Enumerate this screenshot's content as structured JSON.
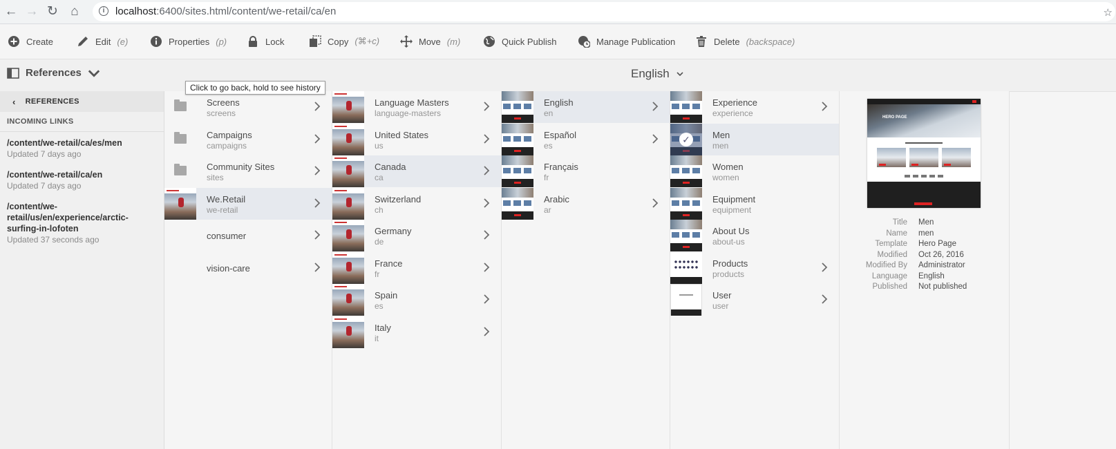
{
  "browser": {
    "url_host": "localhost",
    "url_rest": ":6400/sites.html/content/we-retail/ca/en"
  },
  "toolbar": [
    {
      "label": "Create",
      "kbd": "",
      "icon": "plus-circle-icon"
    },
    {
      "label": "Edit",
      "kbd": "(e)",
      "icon": "pencil-icon"
    },
    {
      "label": "Properties",
      "kbd": "(p)",
      "icon": "info-icon"
    },
    {
      "label": "Lock",
      "kbd": "",
      "icon": "lock-icon"
    },
    {
      "label": "Copy",
      "kbd": "(⌘+c)",
      "icon": "copy-icon"
    },
    {
      "label": "Move",
      "kbd": "(m)",
      "icon": "move-icon"
    },
    {
      "label": "Quick Publish",
      "kbd": "",
      "icon": "globe-icon"
    },
    {
      "label": "Manage Publication",
      "kbd": "",
      "icon": "globe-clock-icon"
    },
    {
      "label": "Delete",
      "kbd": "(backspace)",
      "icon": "trash-icon"
    }
  ],
  "rail": {
    "toggle_label": "References",
    "back_label": "REFERENCES",
    "section": "INCOMING LINKS",
    "links": [
      {
        "path": "/content/we-retail/ca/es/men",
        "updated": "Updated 7 days ago"
      },
      {
        "path": "/content/we-retail/ca/en",
        "updated": "Updated 7 days ago"
      },
      {
        "path": "/content/we-retail/us/en/experience/arctic-surfing-in-lofoten",
        "updated": "Updated 37 seconds ago"
      }
    ]
  },
  "header": {
    "title": "English"
  },
  "tooltip": "Click to go back, hold to see history",
  "columns": [
    [
      {
        "title": "Screens",
        "name": "screens",
        "thumb": "folder",
        "chevron": true,
        "selected": false
      },
      {
        "title": "Campaigns",
        "name": "campaigns",
        "thumb": "folder",
        "chevron": true,
        "selected": false
      },
      {
        "title": "Community Sites",
        "name": "sites",
        "thumb": "folder",
        "chevron": true,
        "selected": false
      },
      {
        "title": "We.Retail",
        "name": "we-retail",
        "thumb": "hero",
        "chevron": true,
        "selected": true
      },
      {
        "title": "consumer",
        "name": "",
        "thumb": "none",
        "chevron": true,
        "selected": false
      },
      {
        "title": "vision-care",
        "name": "",
        "thumb": "none",
        "chevron": true,
        "selected": false
      }
    ],
    [
      {
        "title": "Language Masters",
        "name": "language-masters",
        "thumb": "hero",
        "chevron": true,
        "selected": false
      },
      {
        "title": "United States",
        "name": "us",
        "thumb": "hero",
        "chevron": true,
        "selected": false
      },
      {
        "title": "Canada",
        "name": "ca",
        "thumb": "hero",
        "chevron": true,
        "selected": true
      },
      {
        "title": "Switzerland",
        "name": "ch",
        "thumb": "hero",
        "chevron": true,
        "selected": false
      },
      {
        "title": "Germany",
        "name": "de",
        "thumb": "hero",
        "chevron": true,
        "selected": false
      },
      {
        "title": "France",
        "name": "fr",
        "thumb": "hero",
        "chevron": true,
        "selected": false
      },
      {
        "title": "Spain",
        "name": "es",
        "thumb": "hero",
        "chevron": true,
        "selected": false
      },
      {
        "title": "Italy",
        "name": "it",
        "thumb": "hero",
        "chevron": true,
        "selected": false
      }
    ],
    [
      {
        "title": "English",
        "name": "en",
        "thumb": "site",
        "chevron": true,
        "selected": true
      },
      {
        "title": "Español",
        "name": "es",
        "thumb": "site",
        "chevron": true,
        "selected": false
      },
      {
        "title": "Français",
        "name": "fr",
        "thumb": "site",
        "chevron": false,
        "selected": false
      },
      {
        "title": "Arabic",
        "name": "ar",
        "thumb": "site",
        "chevron": true,
        "selected": false
      }
    ],
    [
      {
        "title": "Experience",
        "name": "experience",
        "thumb": "site",
        "chevron": true,
        "selected": false
      },
      {
        "title": "Men",
        "name": "men",
        "thumb": "checked",
        "chevron": false,
        "selected": true
      },
      {
        "title": "Women",
        "name": "women",
        "thumb": "site",
        "chevron": false,
        "selected": false
      },
      {
        "title": "Equipment",
        "name": "equipment",
        "thumb": "site",
        "chevron": false,
        "selected": false
      },
      {
        "title": "About Us",
        "name": "about-us",
        "thumb": "site",
        "chevron": false,
        "selected": false
      },
      {
        "title": "Products",
        "name": "products",
        "thumb": "products",
        "chevron": true,
        "selected": false
      },
      {
        "title": "User",
        "name": "user",
        "thumb": "user",
        "chevron": true,
        "selected": false
      }
    ]
  ],
  "preview": {
    "hero_text": "HERO PAGE",
    "meta": [
      {
        "k": "Title",
        "v": "Men"
      },
      {
        "k": "Name",
        "v": "men"
      },
      {
        "k": "Template",
        "v": "Hero Page"
      },
      {
        "k": "Modified",
        "v": "Oct 26, 2016"
      },
      {
        "k": "Modified By",
        "v": "Administrator"
      },
      {
        "k": "Language",
        "v": "English"
      },
      {
        "k": "Published",
        "v": "Not published"
      }
    ]
  }
}
